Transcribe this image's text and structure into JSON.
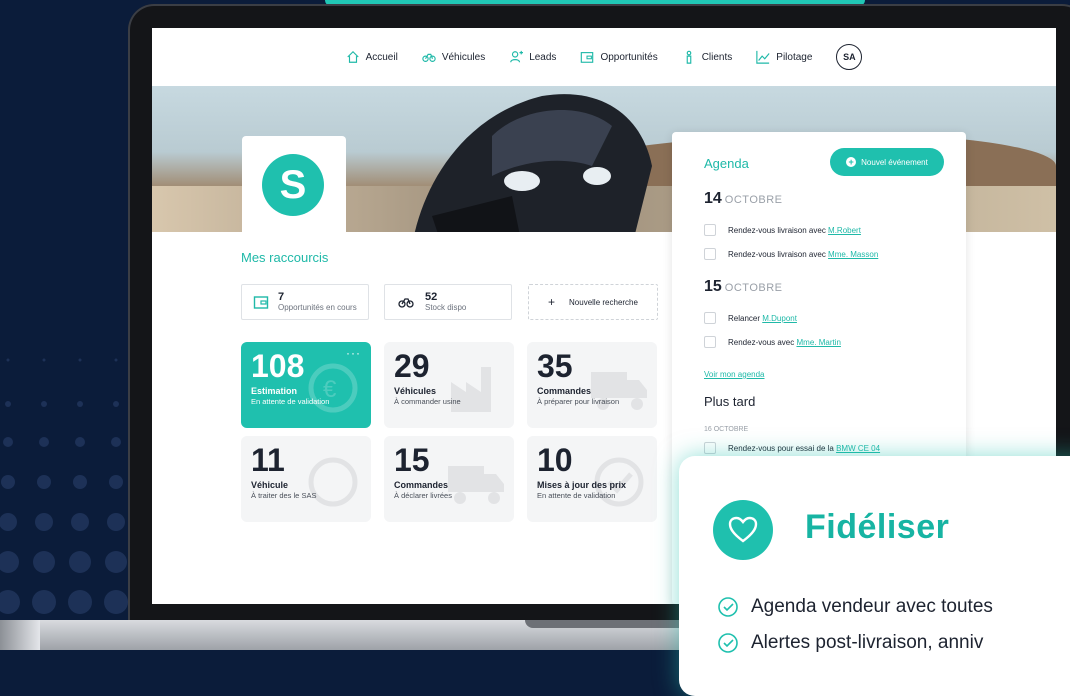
{
  "nav": {
    "items": [
      {
        "label": "Accueil",
        "icon": "home-icon"
      },
      {
        "label": "Véhicules",
        "icon": "bike-icon"
      },
      {
        "label": "Leads",
        "icon": "user-plus-icon"
      },
      {
        "label": "Opportunités",
        "icon": "wallet-icon"
      },
      {
        "label": "Clients",
        "icon": "person-icon"
      },
      {
        "label": "Pilotage",
        "icon": "chart-icon"
      }
    ],
    "avatar": "SA"
  },
  "logo": {
    "letter": "S"
  },
  "shortcuts": {
    "title": "Mes raccourcis",
    "items": [
      {
        "num": "7",
        "label": "Opportunités en cours",
        "icon": "wallet-icon"
      },
      {
        "num": "52",
        "label": "Stock dispo",
        "icon": "bike-icon"
      }
    ],
    "new_search": "Nouvelle recherche"
  },
  "tiles": [
    {
      "big": "108",
      "title": "Estimation",
      "sub": "En attente de validation",
      "icon": "euro-refresh-icon",
      "active": true
    },
    {
      "big": "29",
      "title": "Véhicules",
      "sub": "À commander usine",
      "icon": "factory-icon",
      "active": false
    },
    {
      "big": "35",
      "title": "Commandes",
      "sub": "À préparer pour livraison",
      "icon": "truck-icon",
      "active": false
    },
    {
      "big": "11",
      "title": "Véhicule",
      "sub": "À traiter des le SAS",
      "icon": "refresh-icon",
      "active": false
    },
    {
      "big": "15",
      "title": "Commandes",
      "sub": "À déclarer livrées",
      "icon": "truck-check-icon",
      "active": false
    },
    {
      "big": "10",
      "title": "Mises à jour des prix",
      "sub": "En attente de validation",
      "icon": "check-refresh-icon",
      "active": false
    }
  ],
  "agenda": {
    "title": "Agenda",
    "new_event": "Nouvel événement",
    "days": [
      {
        "day": "14",
        "month": "OCTOBRE",
        "events": [
          {
            "text": "Rendez-vous livraison avec ",
            "link": "M.Robert"
          },
          {
            "text": "Rendez-vous livraison avec ",
            "link": "Mme. Masson"
          }
        ]
      },
      {
        "day": "15",
        "month": "OCTOBRE",
        "events": [
          {
            "text": "Relancer ",
            "link": "M.Dupont"
          },
          {
            "text": "Rendez-vous avec ",
            "link": "Mme. Martin"
          }
        ]
      }
    ],
    "see_all": "Voir mon agenda",
    "later_title": "Plus tard",
    "later_date": "16 OCTOBRE",
    "later_event": {
      "text": "Rendez-vous pour essai de la ",
      "link": "BMW CE 04"
    }
  },
  "overlay": {
    "title": "Fidéliser",
    "lines": [
      "Agenda vendeur avec toutes",
      "Alertes post-livraison, anniv"
    ]
  },
  "colors": {
    "accent": "#1fc0ae",
    "background": "#0b1c3a",
    "text": "#1d2330"
  }
}
